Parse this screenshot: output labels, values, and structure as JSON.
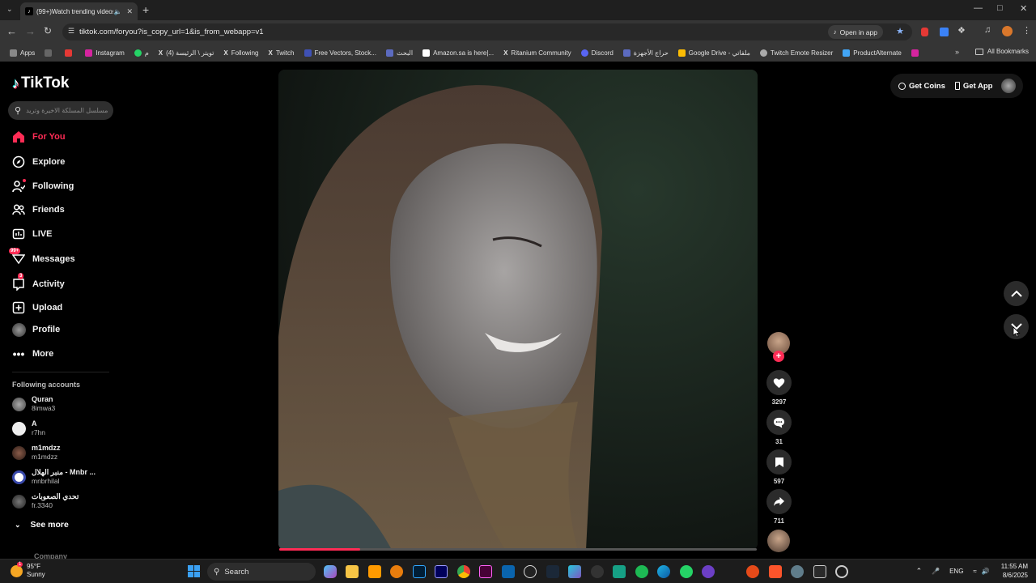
{
  "browser": {
    "tab_title": "(99+)Watch trending videos",
    "url": "tiktok.com/foryou?is_copy_url=1&is_from_webapp=v1",
    "open_in_app": "Open in app",
    "bookmarks": [
      "Apps",
      "Instagram",
      "م",
      "تويتر \\ الرئيسة (4)",
      "Following",
      "Twitch",
      "Free Vectors, Stock...",
      "البحث",
      "Amazon.sa is here|...",
      "Ritanium Community",
      "Discord",
      "حراج الأجهزة",
      "Google Drive - ملفاتي",
      "Twitch Emote Resizer",
      "ProductAlternate"
    ],
    "all_bookmarks": "All Bookmarks"
  },
  "tiktok": {
    "logo": "TikTok",
    "search_placeholder": "مسلسل المسلكة الاخيرة وتريد",
    "nav": {
      "for_you": "For You",
      "explore": "Explore",
      "following": "Following",
      "friends": "Friends",
      "live": "LIVE",
      "messages": "Messages",
      "messages_badge": "99+",
      "activity": "Activity",
      "activity_badge": "3",
      "upload": "Upload",
      "profile": "Profile",
      "more": "More"
    },
    "following_accounts_title": "Following accounts",
    "following_accounts": [
      {
        "name": "Quran",
        "handle": "8imwa3"
      },
      {
        "name": "A",
        "handle": "r7hn"
      },
      {
        "name": "m1mdzz",
        "handle": "m1mdzz"
      },
      {
        "name": "منبر الهلال - Mnbr ...",
        "handle": "mnbrhilal"
      },
      {
        "name": "تحدي الصعوبات",
        "handle": "fr.3340"
      }
    ],
    "see_more": "See more",
    "company": "Company",
    "get_coins": "Get Coins",
    "get_app": "Get App",
    "actions": {
      "likes": "3297",
      "comments": "31",
      "saves": "597",
      "shares": "711"
    },
    "video_progress": 0.17
  },
  "taskbar": {
    "temp": "95°F",
    "condition": "Sunny",
    "weather_badge": "1",
    "search": "Search",
    "lang": "ENG",
    "time": "11:55 AM",
    "date": "8/6/2025"
  },
  "colors": {
    "accent": "#fe2c55",
    "chrome_dark": "#1f1f1f",
    "chrome_mid": "#353535"
  }
}
